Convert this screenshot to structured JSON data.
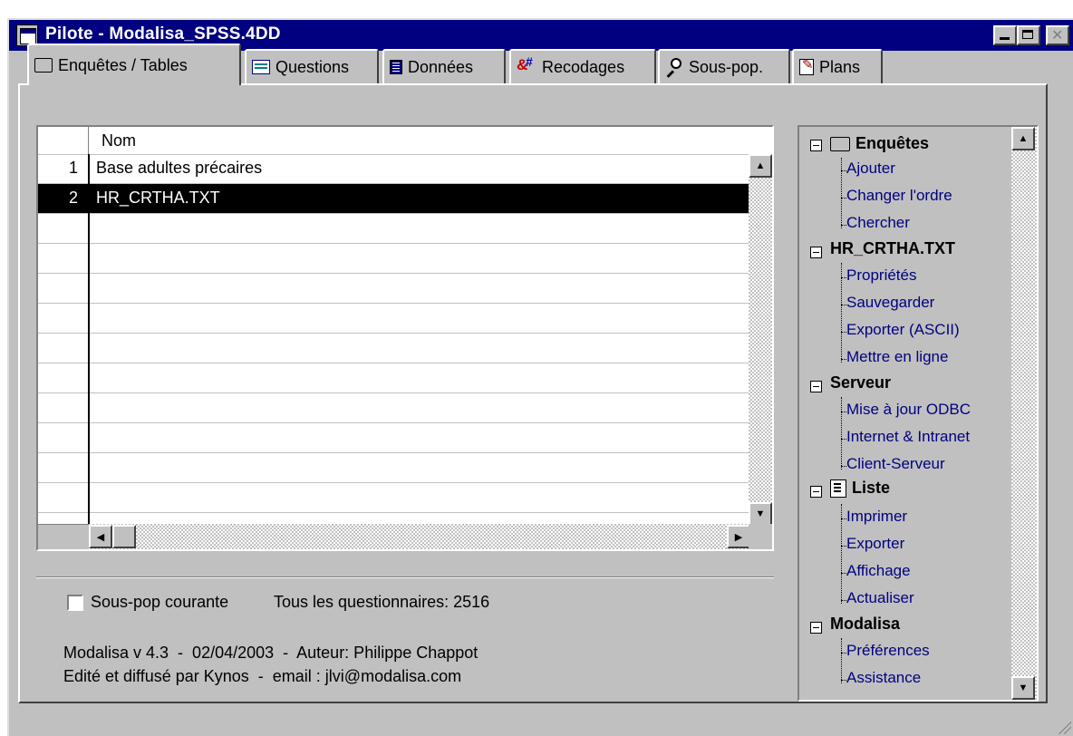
{
  "window": {
    "title": "Pilote - Modalisa_SPSS.4DD"
  },
  "tabs": [
    {
      "label": "Enquêtes / Tables",
      "icon": "folder-icon",
      "active": true
    },
    {
      "label": "Questions",
      "icon": "questions-icon",
      "active": false
    },
    {
      "label": "Données",
      "icon": "data-icon",
      "active": false
    },
    {
      "label": "Recodages",
      "icon": "recode-icon",
      "active": false
    },
    {
      "label": "Sous-pop.",
      "icon": "search-icon",
      "active": false
    },
    {
      "label": "Plans",
      "icon": "plans-icon",
      "active": false
    }
  ],
  "table": {
    "header": "Nom",
    "rows": [
      {
        "num": "1",
        "name": "Base adultes précaires"
      },
      {
        "num": "2",
        "name": "HR_CRTHA.TXT"
      }
    ]
  },
  "footer": {
    "checkbox_label": "Sous-pop courante",
    "count_text": "Tous les questionnaires: 2516",
    "version_line": "Modalisa v 4.3  -  02/04/2003  -  Auteur: Philippe Chappot",
    "publisher_line": "Edité et diffusé par Kynos  -  email : jlvi@modalisa.com"
  },
  "tree": {
    "groups": [
      {
        "label": "Enquêtes",
        "items": [
          "Ajouter",
          "Changer l'ordre",
          "Chercher"
        ]
      },
      {
        "label": "HR_CRTHA.TXT",
        "items": [
          "Propriétés",
          "Sauvegarder",
          "Exporter (ASCII)",
          "Mettre en ligne"
        ]
      },
      {
        "label": "Serveur",
        "items": [
          "Mise à jour ODBC",
          "Internet & Intranet",
          "Client-Serveur"
        ]
      },
      {
        "label": "Liste",
        "items": [
          "Imprimer",
          "Exporter",
          "Affichage",
          "Actualiser"
        ]
      },
      {
        "label": "Modalisa",
        "items": [
          "Préférences",
          "Assistance"
        ]
      }
    ]
  }
}
